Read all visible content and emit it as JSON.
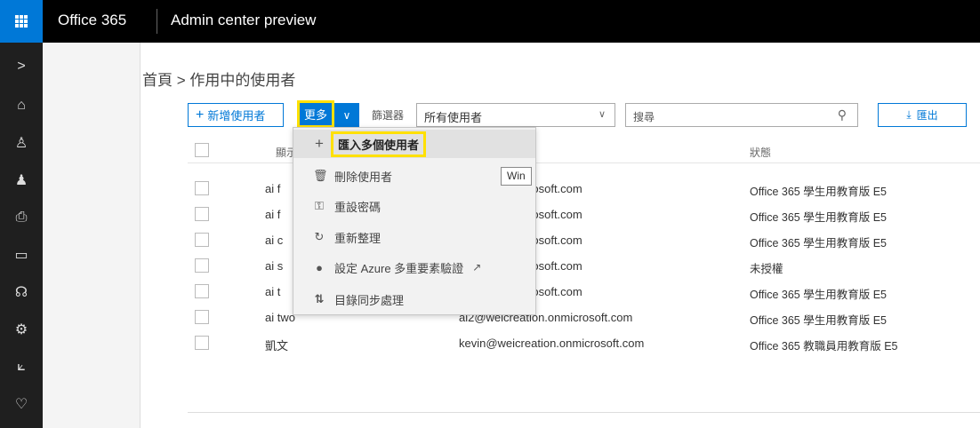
{
  "topbar": {
    "brand": "Office 365",
    "app_title": "Admin center preview"
  },
  "nav": {
    "items": [
      {
        "name": "expand-chevron-icon",
        "glyph": ">"
      },
      {
        "name": "home-icon",
        "glyph": "⌂"
      },
      {
        "name": "user-icon",
        "glyph": "♙"
      },
      {
        "name": "groups-icon",
        "glyph": "♟"
      },
      {
        "name": "resources-icon",
        "glyph": "⎙"
      },
      {
        "name": "billing-icon",
        "glyph": "▭"
      },
      {
        "name": "support-icon",
        "glyph": "☊"
      },
      {
        "name": "settings-icon",
        "glyph": "⚙"
      },
      {
        "name": "reports-icon",
        "glyph": "⟀"
      },
      {
        "name": "health-icon",
        "glyph": "♡"
      }
    ]
  },
  "breadcrumb": "首頁 > 作用中的使用者",
  "toolbar": {
    "add_user": "新增使用者",
    "more": "更多",
    "filter_label": "篩選器",
    "filter_value": "所有使用者",
    "search_placeholder": "搜尋",
    "export": "匯出"
  },
  "table": {
    "col_name": "顯示",
    "col_status": "狀態",
    "rows": [
      {
        "name": "ai f",
        "email": "reation.onmicrosoft.com",
        "status": "Office 365 學生用教育版 E5"
      },
      {
        "name": "ai f",
        "email": "reation.onmicrosoft.com",
        "status": "Office 365 學生用教育版 E5"
      },
      {
        "name": "ai c",
        "email": "reation.onmicrosoft.com",
        "status": "Office 365 學生用教育版 E5"
      },
      {
        "name": "ai s",
        "email": "reation.onmicrosoft.com",
        "status": "未授權"
      },
      {
        "name": "ai t",
        "email": "reation.onmicrosoft.com",
        "status": "Office 365 學生用教育版 E5"
      },
      {
        "name": "ai two",
        "email": "ai2@weicreation.onmicrosoft.com",
        "status": "Office 365 學生用教育版 E5"
      },
      {
        "name": "凱文",
        "email": "kevin@weicreation.onmicrosoft.com",
        "status": "Office 365 教職員用教育版 E5"
      }
    ]
  },
  "menu": {
    "import": "匯入多個使用者",
    "delete": "刪除使用者",
    "reset_password": "重設密碼",
    "refresh": "重新整理",
    "mfa": "設定 Azure 多重要素驗證",
    "dir_sync": "目錄同步處理"
  },
  "tooltip": "Win",
  "colors": {
    "accent": "#0078d7",
    "highlight": "#ffe000",
    "topbar": "#000000"
  }
}
